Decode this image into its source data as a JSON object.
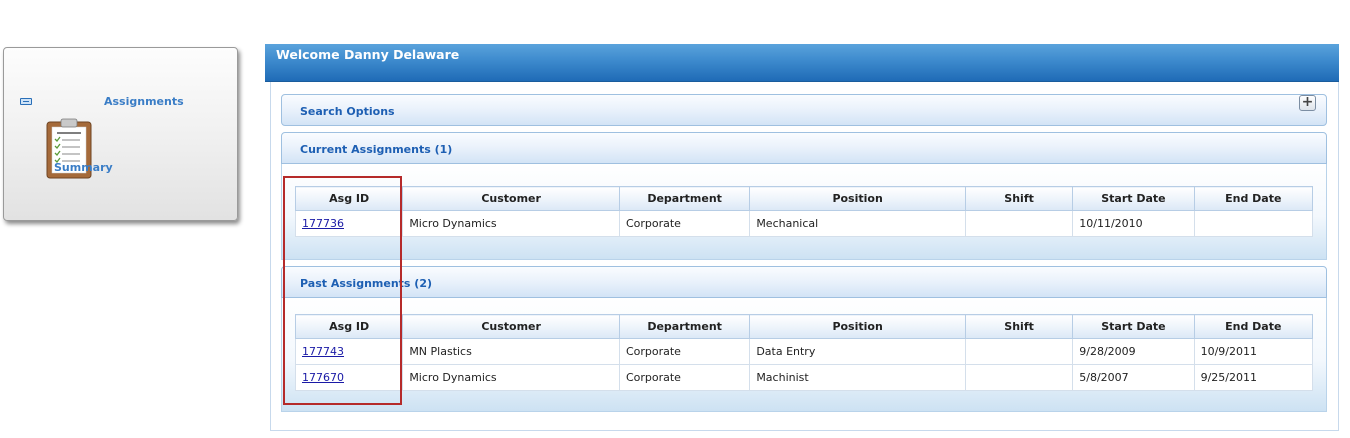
{
  "nav": {
    "items": [
      {
        "label": "Assignments"
      },
      {
        "label": "Summary"
      }
    ]
  },
  "header": {
    "welcome": "Welcome Danny Delaware"
  },
  "search": {
    "title": "Search Options",
    "expand_symbol": "+"
  },
  "current": {
    "title": "Current Assignments (1)",
    "columns": [
      "Asg ID",
      "Customer",
      "Department",
      "Position",
      "Shift",
      "Start Date",
      "End Date"
    ],
    "rows": [
      {
        "asg_id": "177736",
        "customer": "Micro Dynamics",
        "department": "Corporate",
        "position": "Mechanical",
        "shift": "",
        "start_date": "10/11/2010",
        "end_date": ""
      }
    ]
  },
  "past": {
    "title": "Past Assignments (2)",
    "columns": [
      "Asg ID",
      "Customer",
      "Department",
      "Position",
      "Shift",
      "Start Date",
      "End Date"
    ],
    "rows": [
      {
        "asg_id": "177743",
        "customer": "MN Plastics",
        "department": "Corporate",
        "position": "Data Entry",
        "shift": "",
        "start_date": "9/28/2009",
        "end_date": "10/9/2011"
      },
      {
        "asg_id": "177670",
        "customer": "Micro Dynamics",
        "department": "Corporate",
        "position": "Machinist",
        "shift": "",
        "start_date": "5/8/2007",
        "end_date": "9/25/2011"
      }
    ]
  },
  "colors": {
    "header_blue": "#3d8acd",
    "section_title": "#1d5fb3",
    "nav_label": "#3a7dc6",
    "link": "#1a1aa6",
    "highlight": "#b52a2a"
  }
}
